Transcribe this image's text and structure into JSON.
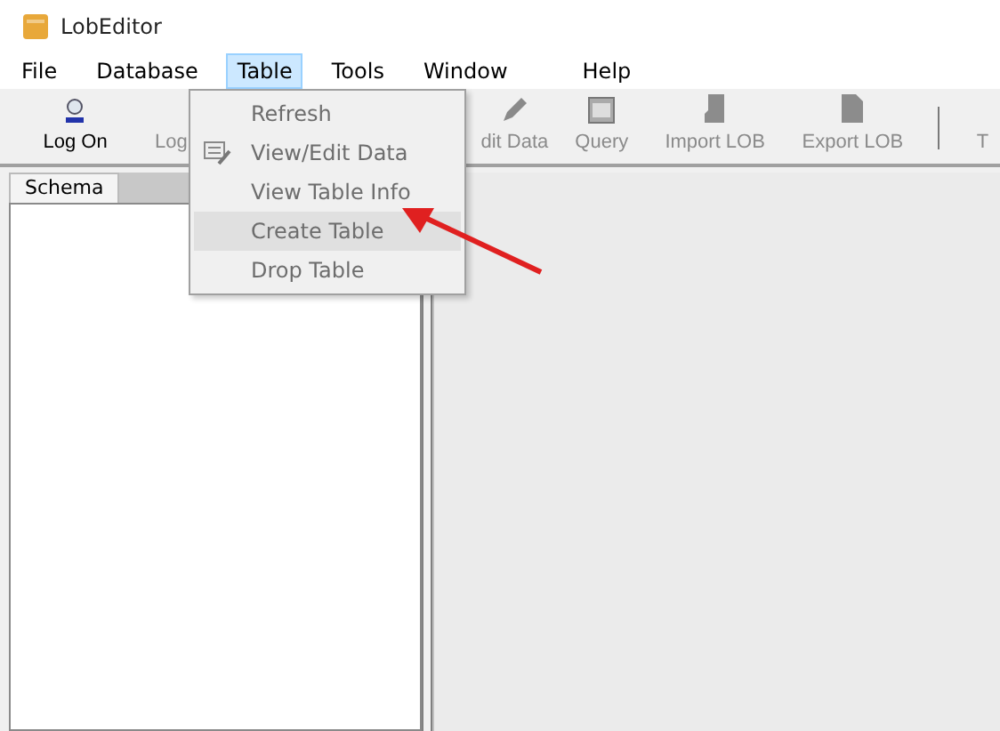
{
  "window": {
    "title": "LobEditor"
  },
  "menu_bar": [
    {
      "label": "File",
      "selected": false
    },
    {
      "label": "Database",
      "selected": false
    },
    {
      "label": "Table",
      "selected": true
    },
    {
      "label": "Tools",
      "selected": false
    },
    {
      "label": "Window",
      "selected": false
    },
    {
      "label": "Help",
      "selected": false
    }
  ],
  "toolbar": [
    {
      "label": "Log On",
      "kind": "user",
      "disabled": false
    },
    {
      "label": "Log",
      "kind": "none",
      "disabled": true
    },
    {
      "label": "dit Data",
      "kind": "edit",
      "disabled": true
    },
    {
      "label": "Query",
      "kind": "query",
      "disabled": true
    },
    {
      "label": "Import LOB",
      "kind": "import",
      "disabled": true
    },
    {
      "label": "Export LOB",
      "kind": "export",
      "disabled": true
    },
    {
      "label": "T",
      "kind": "none",
      "disabled": true
    }
  ],
  "tabs": [
    {
      "label": "Schema",
      "selected": true
    }
  ],
  "dropdown": [
    {
      "label": "Refresh",
      "icon": false,
      "selected": false,
      "disabled": true
    },
    {
      "label": "View/Edit Data",
      "icon": true,
      "selected": false,
      "disabled": true
    },
    {
      "label": "View Table Info",
      "icon": false,
      "selected": false,
      "disabled": true
    },
    {
      "label": "Create Table",
      "icon": false,
      "selected": true,
      "disabled": true
    },
    {
      "label": "Drop Table",
      "icon": false,
      "selected": false,
      "disabled": true
    }
  ]
}
